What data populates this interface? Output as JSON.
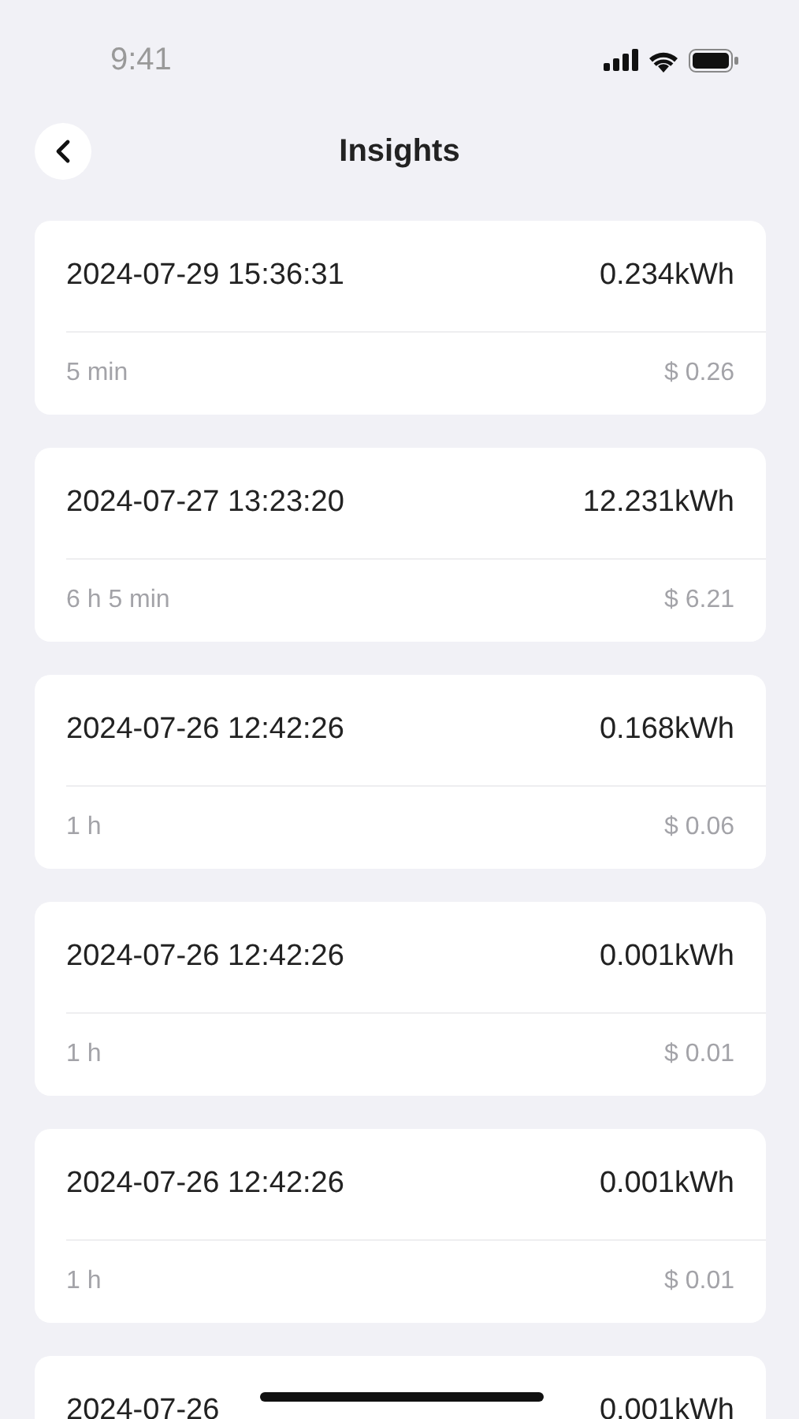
{
  "status_bar": {
    "time": "9:41"
  },
  "header": {
    "title": "Insights"
  },
  "records": [
    {
      "datetime": "2024-07-29 15:36:31",
      "energy": "0.234kWh",
      "duration": "5 min",
      "cost": "$ 0.26"
    },
    {
      "datetime": "2024-07-27 13:23:20",
      "energy": "12.231kWh",
      "duration": "6 h 5 min",
      "cost": "$ 6.21"
    },
    {
      "datetime": "2024-07-26 12:42:26",
      "energy": "0.168kWh",
      "duration": "1 h",
      "cost": "$ 0.06"
    },
    {
      "datetime": "2024-07-26 12:42:26",
      "energy": "0.001kWh",
      "duration": "1 h",
      "cost": "$ 0.01"
    },
    {
      "datetime": "2024-07-26 12:42:26",
      "energy": "0.001kWh",
      "duration": "1 h",
      "cost": "$ 0.01"
    },
    {
      "datetime": "2024-07-26",
      "energy": "0.001kWh"
    }
  ]
}
